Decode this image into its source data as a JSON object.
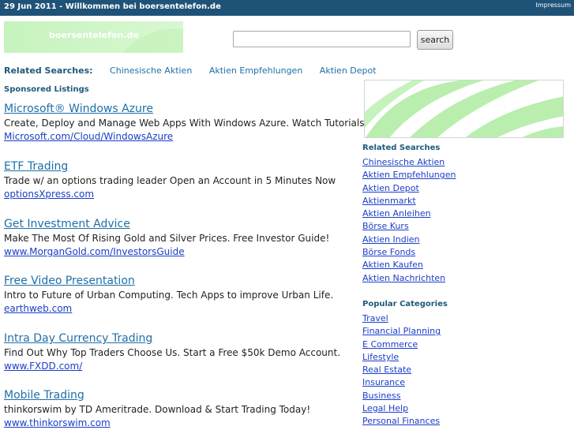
{
  "header": {
    "date_title": "29 Jun 2011 - Willkommen bei boersentelefon.de",
    "impressum": "Impressum"
  },
  "logo": {
    "text": "boersentelefon.de"
  },
  "search": {
    "value": "",
    "button": "search"
  },
  "related_top": {
    "label": "Related Searches:",
    "links": [
      "Chinesische Aktien",
      "Aktien Empfehlungen",
      "Aktien Depot"
    ]
  },
  "sponsored_label": "Sponsored Listings",
  "ads": [
    {
      "title": "Microsoft® Windows Azure",
      "desc": "Create, Deploy and Manage Web Apps With Windows Azure. Watch Tutorials",
      "url": "Microsoft.com/Cloud/WindowsAzure"
    },
    {
      "title": "ETF Trading",
      "desc": "Trade w/ an options trading leader Open an Account in 5 Minutes Now",
      "url": "optionsXpress.com"
    },
    {
      "title": "Get Investment Advice",
      "desc": "Make The Most Of Rising Gold and Silver Prices. Free Investor Guide!",
      "url": "www.MorganGold.com/InvestorsGuide"
    },
    {
      "title": "Free Video Presentation",
      "desc": "Intro to Future of Urban Computing. Tech Apps to improve Urban Life.",
      "url": "earthweb.com"
    },
    {
      "title": "Intra Day Currency Trading",
      "desc": "Find Out Why Top Traders Choose Us. Start a Free $50k Demo Account.",
      "url": "www.FXDD.com/"
    },
    {
      "title": "Mobile Trading",
      "desc": "thinkorswim by TD Ameritrade. Download & Start Trading Today!",
      "url": "www.thinkorswim.com"
    }
  ],
  "sidebar": {
    "related_heading": "Related Searches",
    "related": [
      "Chinesische Aktien",
      "Aktien Empfehlungen",
      "Aktien Depot",
      "Aktienmarkt",
      "Aktien Anleihen",
      "Börse Kurs",
      "Aktien Indien",
      "Börse Fonds",
      "Aktien Kaufen",
      "Aktien Nachrichten"
    ],
    "popular_heading": "Popular Categories",
    "popular": [
      "Travel",
      "Financial Planning",
      "E Commerce",
      "Lifestyle",
      "Real Estate",
      "Insurance",
      "Business",
      "Legal Help",
      "Personal Finances"
    ]
  }
}
